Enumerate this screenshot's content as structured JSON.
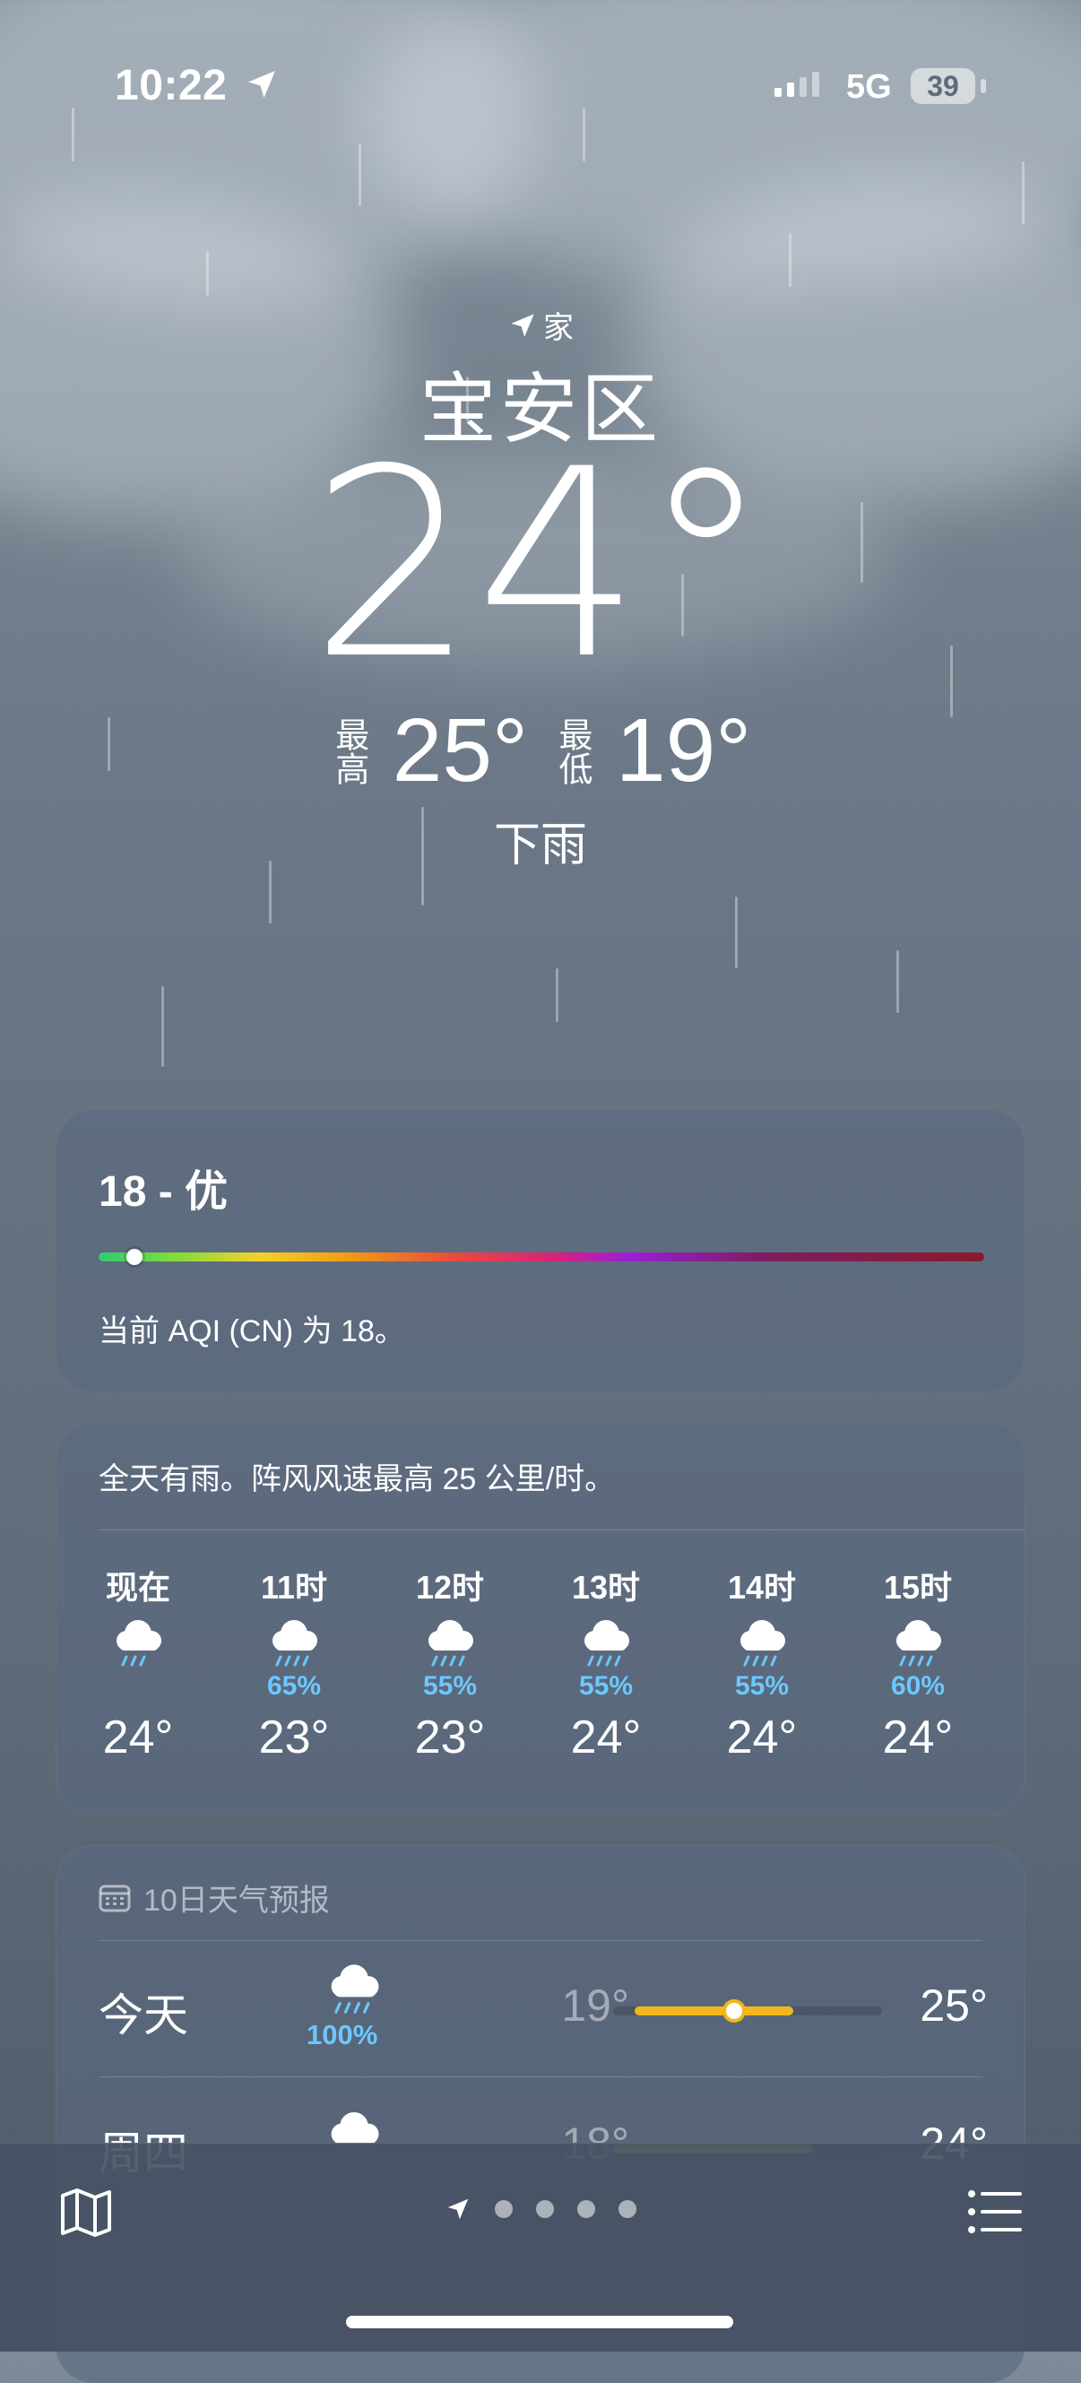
{
  "status_bar": {
    "time": "10:22",
    "network": "5G",
    "battery": "39"
  },
  "location": {
    "tag": "家",
    "city": "宝安区",
    "temperature": "24°",
    "high_label": "最高",
    "high": "25°",
    "low_label": "最低",
    "low": "19°",
    "condition": "下雨"
  },
  "aqi": {
    "title": "18 - 优",
    "description": "当前 AQI (CN) 为 18。",
    "value_fraction": 0.04
  },
  "hourly": {
    "summary": "全天有雨。阵风风速最高 25 公里/时。",
    "items": [
      {
        "label": "现在",
        "prob": "",
        "temp": "24°"
      },
      {
        "label": "11时",
        "prob": "65%",
        "temp": "23°"
      },
      {
        "label": "12时",
        "prob": "55%",
        "temp": "23°"
      },
      {
        "label": "13时",
        "prob": "55%",
        "temp": "24°"
      },
      {
        "label": "14时",
        "prob": "55%",
        "temp": "24°"
      },
      {
        "label": "15时",
        "prob": "60%",
        "temp": "24°"
      }
    ]
  },
  "daily": {
    "header": "10日天气预报",
    "days": [
      {
        "name": "今天",
        "prob": "100%",
        "low": "19°",
        "high": "25°",
        "range_start": 0.08,
        "range_end": 0.67,
        "current": 0.45
      },
      {
        "name": "周四",
        "prob": "",
        "low": "18°",
        "high": "24°",
        "range_start": 0.0,
        "range_end": 0.74
      }
    ]
  },
  "colors": {
    "precip": "#6cc8ff",
    "today_range": "#f1b81a",
    "thu_range": "#e2cf5a"
  },
  "icons": [
    "location-arrow-icon",
    "map-icon",
    "list-icon",
    "rain-cloud-icon",
    "cloud-icon",
    "calendar-icon"
  ]
}
